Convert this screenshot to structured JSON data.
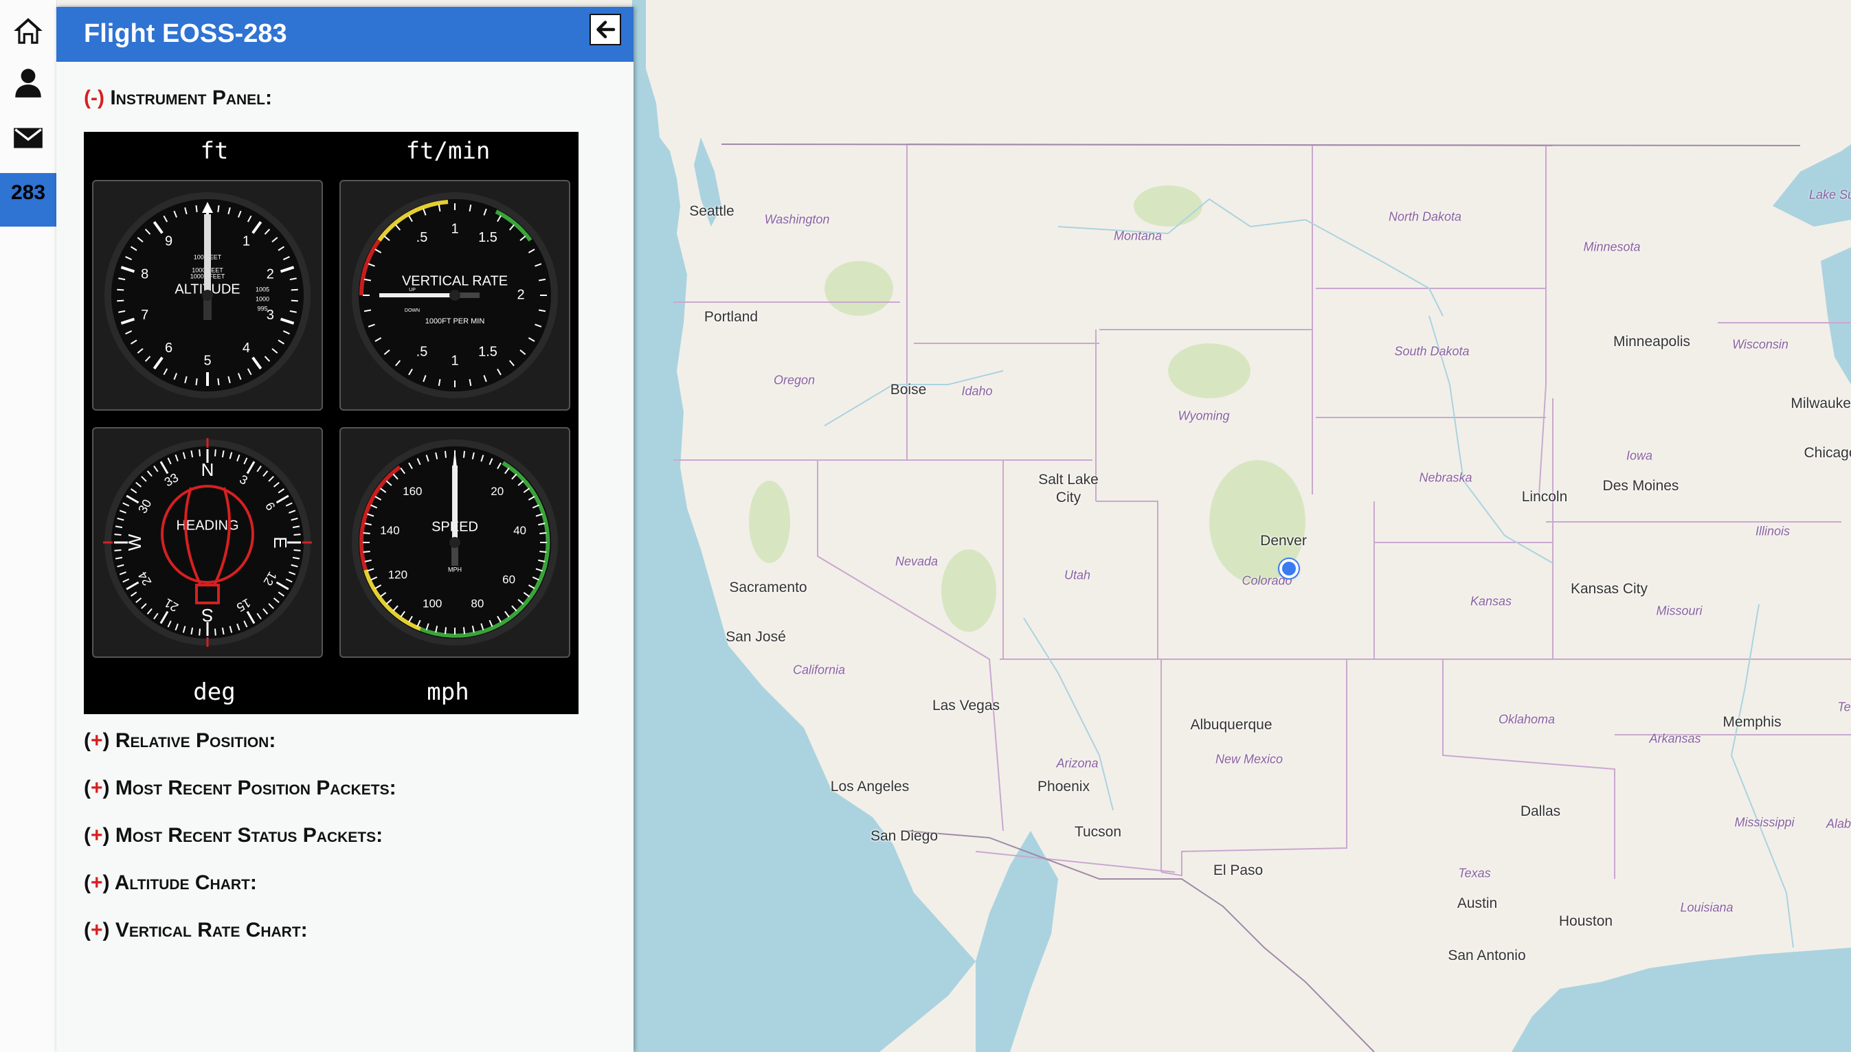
{
  "sidebar": {
    "home_icon": "home-icon",
    "user_icon": "user-icon",
    "mail_icon": "mail-icon",
    "active_flight_label": "283"
  },
  "panel": {
    "title": "Flight EOSS-283",
    "close_icon": "arrow-left-icon",
    "instrument_toggle": "(-)",
    "instrument_label": "Instrument Panel:",
    "instruments": {
      "altitude": {
        "unit": "ft",
        "label": "ALTITUDE",
        "numbers": [
          "0",
          "1",
          "2",
          "3",
          "4",
          "5",
          "6",
          "7",
          "8",
          "9"
        ],
        "sublabel_top": "100 FEET",
        "sublabel_mid": "1000 FEET\n10000 FEET",
        "baro": [
          "1005",
          "1000",
          "995"
        ]
      },
      "vertical_rate": {
        "unit": "ft/min",
        "label": "VERTICAL RATE",
        "sublabel": "1000FT PER MIN",
        "up": "UP",
        "down": "DOWN",
        "numbers": [
          ".5",
          "1",
          "1.5",
          "2",
          "1.5",
          "1",
          ".5"
        ]
      },
      "heading": {
        "unit": "deg",
        "label": "HEADING",
        "numbers": [
          "N",
          "3",
          "6",
          "E",
          "12",
          "15",
          "S",
          "21",
          "24",
          "W",
          "30",
          "33"
        ]
      },
      "speed": {
        "unit": "mph",
        "label": "SPEED",
        "sublabel": "MPH",
        "numbers": [
          "20",
          "40",
          "60",
          "80",
          "100",
          "120",
          "140",
          "160"
        ]
      }
    },
    "sections": [
      {
        "toggle": "(+)",
        "label": "Relative Position:"
      },
      {
        "toggle": "(+)",
        "label": "Most Recent Position Packets:"
      },
      {
        "toggle": "(+)",
        "label": "Most Recent Status Packets:"
      },
      {
        "toggle": "(+)",
        "label": "Altitude Chart:"
      },
      {
        "toggle": "(+)",
        "label": "Vertical Rate Chart:"
      }
    ]
  },
  "map": {
    "cities": [
      "Seattle",
      "Portland",
      "Boise",
      "Salt Lake City",
      "Denver",
      "Sacramento",
      "San José",
      "Las Vegas",
      "Los Angeles",
      "San Diego",
      "Phoenix",
      "Tucson",
      "Albuquerque",
      "El Paso",
      "Minneapolis",
      "Milwaukee",
      "Chicago",
      "Des Moines",
      "Lincoln",
      "Kansas City",
      "Memphis",
      "Dallas",
      "Austin",
      "Houston",
      "San Antonio"
    ],
    "states": [
      "Washington",
      "Montana",
      "North Dakota",
      "Minnesota",
      "Oregon",
      "Idaho",
      "Wyoming",
      "South Dakota",
      "Wisconsin",
      "Iowa",
      "Nebraska",
      "Nevada",
      "Utah",
      "Colorado",
      "Kansas",
      "Missouri",
      "Illinois",
      "California",
      "Arizona",
      "New Mexico",
      "Oklahoma",
      "Arkansas",
      "Texas",
      "Louisiana",
      "Mississippi"
    ],
    "partial_labels": [
      "Lake Su",
      "Te",
      "Alab"
    ],
    "marker_color": "#3a7bf0",
    "water_color": "#aad3df",
    "land_color": "#f2efe9"
  },
  "colors": {
    "header": "#2f73d3",
    "toggle_sign": "#d62020"
  }
}
